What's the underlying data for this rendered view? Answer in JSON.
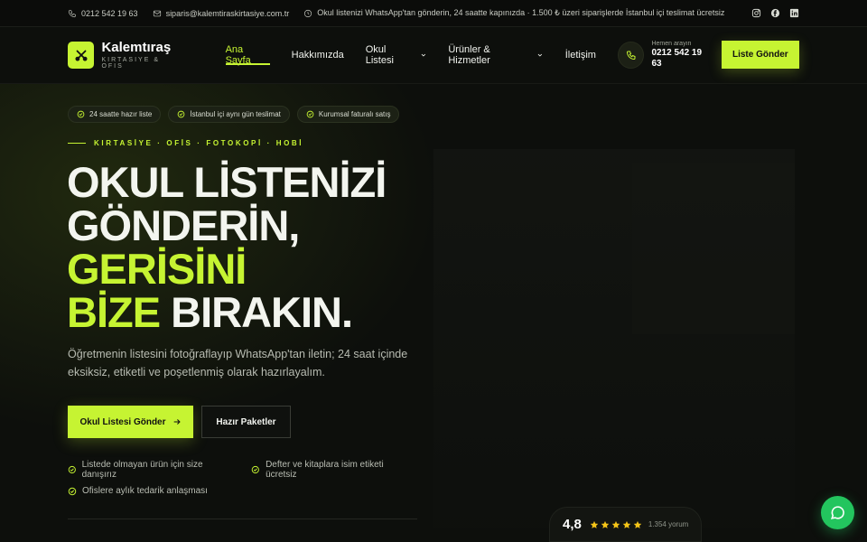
{
  "topbar": {
    "phone": "0212 542 19 63",
    "email": "siparis@kalemtiraskirtasiye.com.tr",
    "notice": "Okul listenizi WhatsApp'tan gönderin, 24 saatte kapınızda · 1.500 ₺ üzeri siparişlerde İstanbul içi teslimat ücretsiz",
    "social_icons": [
      "instagram-icon",
      "facebook-icon",
      "linkedin-icon"
    ]
  },
  "brand": {
    "name": "Kalemtıraş",
    "tagline": "KIRTASIYE & OFIS",
    "accent_color": "#c6f432"
  },
  "nav": {
    "items": [
      {
        "label": "Ana Sayfa",
        "active": true,
        "dropdown": false
      },
      {
        "label": "Hakkımızda",
        "active": false,
        "dropdown": false
      },
      {
        "label": "Okul Listesi",
        "active": false,
        "dropdown": true
      },
      {
        "label": "Ürünler & Hizmetler",
        "active": false,
        "dropdown": true
      },
      {
        "label": "İletişim",
        "active": false,
        "dropdown": false
      }
    ],
    "call_label": "Hemen arayın",
    "call_number": "0212 542 19 63",
    "cta_label": "Liste Gönder"
  },
  "hero": {
    "badges": [
      "24 saatte hazır liste",
      "İstanbul içi aynı gün teslimat",
      "Kurumsal faturalı satış"
    ],
    "eyebrow": "KIRTASİYE · OFİS · FOTOKOPİ · HOBİ",
    "headline": {
      "line1": "OKUL LİSTENİZİ",
      "line2": "GÖNDERİN,",
      "line3_highlight": "GERİSİNİ",
      "line4_highlight": "BİZE",
      "line4_rest": " BIRAKIN."
    },
    "subtext": "Öğretmenin listesini fotoğraflayıp WhatsApp'tan iletin; 24 saat içinde eksiksiz, etiketli ve poşetlenmiş olarak hazırlayalım.",
    "primary_button": "Okul Listesi Gönder",
    "secondary_button": "Hazır Paketler",
    "checks": [
      "Listede olmayan ürün için size danışırız",
      "Defter ve kitaplara isim etiketi ücretsiz",
      "Ofislere aylık tedarik anlaşması"
    ]
  },
  "rating": {
    "score": "4,8",
    "stars": 5,
    "reviews": "1.354 yorum"
  },
  "chat": {
    "color": "#23c55e"
  }
}
